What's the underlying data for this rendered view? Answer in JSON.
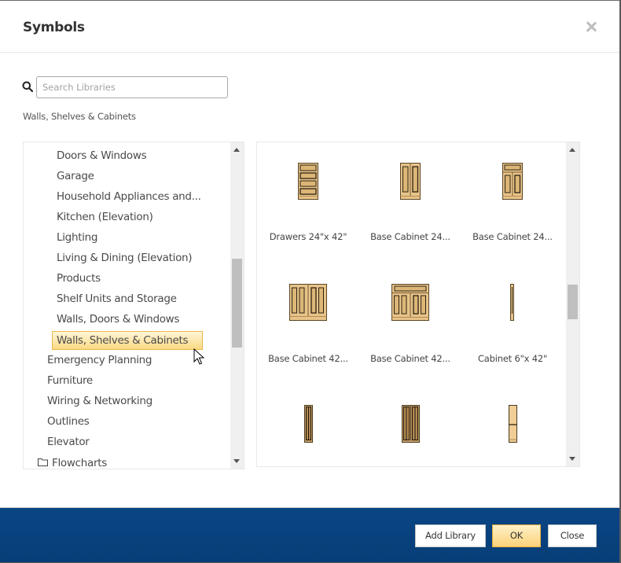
{
  "dialog": {
    "title": "Symbols",
    "close_icon": "close-icon"
  },
  "search": {
    "icon": "search-icon",
    "placeholder": "Search Libraries",
    "value": ""
  },
  "breadcrumb": "Walls, Shelves & Cabinets",
  "tree": {
    "items": [
      {
        "label": "Doors & Windows",
        "level": 2
      },
      {
        "label": "Garage",
        "level": 2
      },
      {
        "label": "Household Appliances and...",
        "level": 2
      },
      {
        "label": "Kitchen (Elevation)",
        "level": 2
      },
      {
        "label": "Lighting",
        "level": 2
      },
      {
        "label": "Living & Dining (Elevation)",
        "level": 2
      },
      {
        "label": "Products",
        "level": 2
      },
      {
        "label": "Shelf Units and Storage",
        "level": 2
      },
      {
        "label": "Walls, Doors & Windows",
        "level": 2
      },
      {
        "label": "Walls, Shelves & Cabinets",
        "level": 2,
        "selected": true
      },
      {
        "label": "Emergency Planning",
        "level": 1
      },
      {
        "label": "Furniture",
        "level": 1
      },
      {
        "label": "Wiring & Networking",
        "level": 1
      },
      {
        "label": "Outlines",
        "level": 1
      },
      {
        "label": "Elevator",
        "level": 1
      },
      {
        "label": "Flowcharts",
        "level": 0,
        "icon": "folder-icon"
      }
    ],
    "scroll_position": 0.45
  },
  "symbols": {
    "items": [
      {
        "label": "Drawers 24\"x 42\"",
        "icon": "drawers-cabinet-icon"
      },
      {
        "label": "Base Cabinet 24...",
        "icon": "base-cabinet-two-door-icon"
      },
      {
        "label": "Base Cabinet 24...",
        "icon": "base-cabinet-drawer-two-door-icon"
      },
      {
        "label": "Base Cabinet 42...",
        "icon": "base-cabinet-four-door-icon"
      },
      {
        "label": "Base Cabinet 42...",
        "icon": "base-cabinet-drawer-four-door-icon"
      },
      {
        "label": "Cabinet 6\"x 42\"",
        "icon": "narrow-cabinet-icon"
      },
      {
        "label": "",
        "icon": "tall-narrow-cabinet-icon"
      },
      {
        "label": "",
        "icon": "tall-double-cabinet-icon"
      },
      {
        "label": "",
        "icon": "tall-shelf-cabinet-icon"
      }
    ],
    "scroll_position": 0.45
  },
  "footer": {
    "add_library": "Add Library",
    "ok": "OK",
    "close": "Close"
  },
  "colors": {
    "footer_bg": "#0a4584",
    "selected_bg": "#fbd983",
    "selected_border": "#eab94a",
    "wood": "#e8c48a",
    "wood_dark": "#5a4526"
  }
}
